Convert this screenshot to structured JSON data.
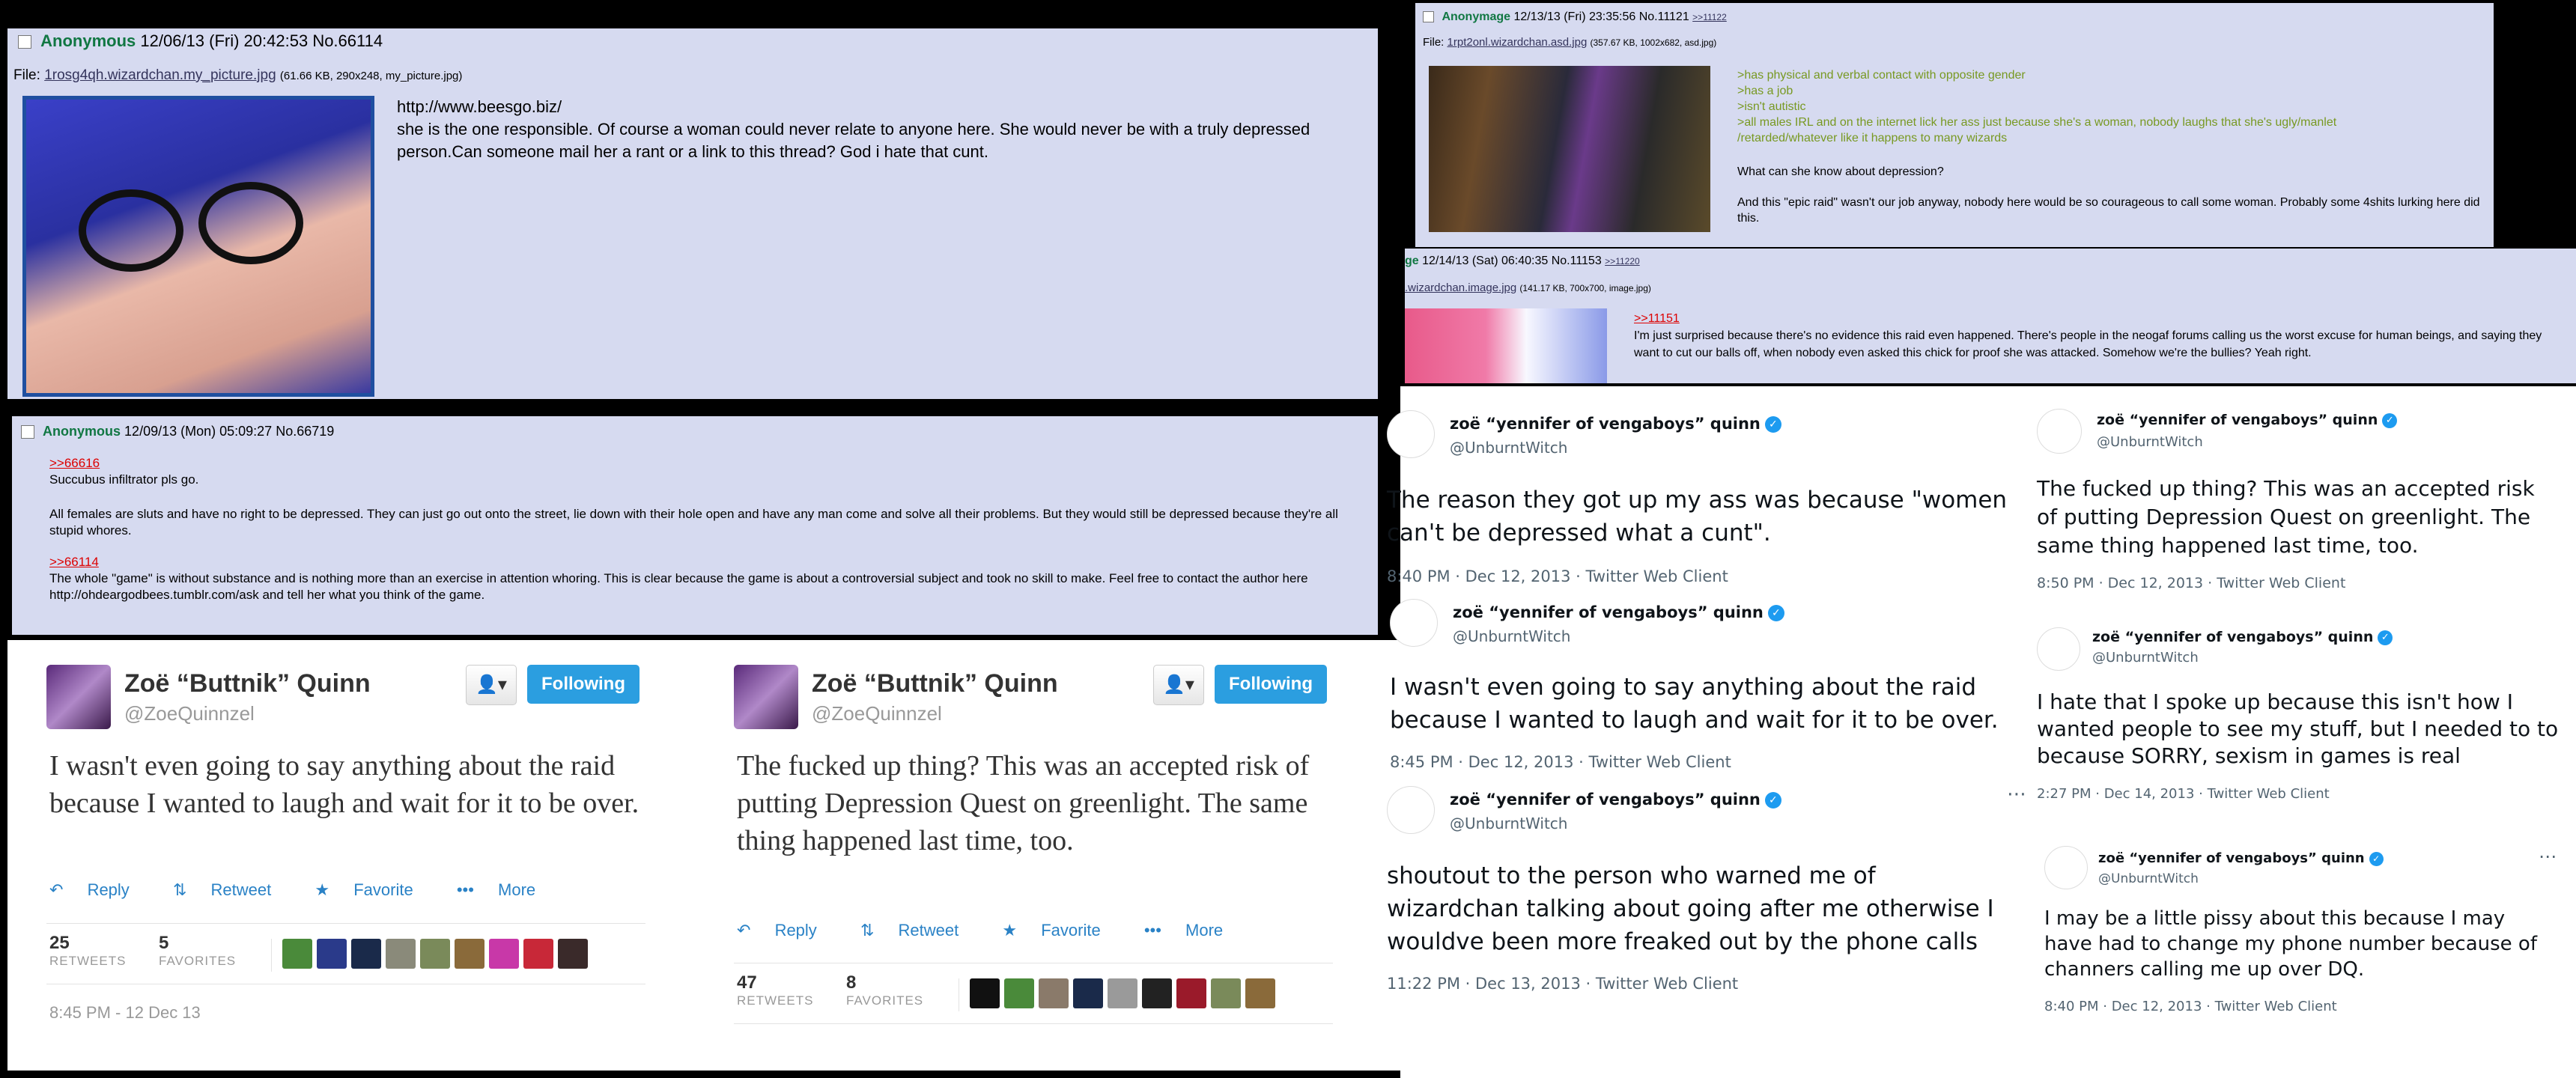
{
  "post1": {
    "name": "Anonymous",
    "datetime": "12/06/13 (Fri) 20:42:53",
    "number": "No.66114",
    "file_label": "File:",
    "file_name": "1rosg4qh.wizardchan.my_picture.jpg",
    "file_info": "(61.66 KB, 290x248, my_picture.jpg)",
    "line1": "http://www.beesgo.biz/",
    "line2": "she is the one responsible. Of course a woman could never relate to anyone here. She would never be with a truly depressed person.Can someone mail her a rant or a link to this thread? God i hate that cunt."
  },
  "post2": {
    "name": "Anonymous",
    "datetime": "12/09/13 (Mon) 05:09:27",
    "number": "No.66719",
    "qlink1": ">>66616",
    "line1": "Succubus infiltrator pls go.",
    "line2": "All females are sluts and have no right to be depressed. They can just go out onto the street, lie down with their hole open and have any man come and solve all their problems. But they would still be depressed because they're all stupid whores.",
    "qlink2": ">>66114",
    "line3": "The whole \"game\" is without substance and is nothing more than an exercise in attention whoring. This is clear because the game is about a controversial subject and took no skill to make. Feel free to contact the author here http://ohdeargodbees.tumblr.com/ask and tell her what you think of the game."
  },
  "post3": {
    "name": "Anonymage",
    "datetime": "12/13/13 (Fri) 23:35:56",
    "number": "No.11121",
    "reply_link": ">>11122",
    "file_label": "File:",
    "file_name": "1rpt2onl.wizardchan.asd.jpg",
    "file_info": "(357.67 KB, 1002x682, asd.jpg)",
    "quotes": [
      ">has physical and verbal contact with opposite gender",
      ">has a job",
      ">isn't autistic",
      ">all males IRL and on the internet lick her ass just because she's a woman, nobody laughs that she's ugly/manlet",
      "/retarded/whatever like it happens to many wizards"
    ],
    "line1": "What can she know about depression?",
    "line2": "And this \"epic raid\" wasn't our job anyway, nobody here would be so courageous to call some woman. Probably some 4shits lurking here did this."
  },
  "post4": {
    "name_fragment": "ge",
    "datetime": "12/14/13 (Sat) 06:40:35",
    "number": "No.11153",
    "reply_link": ">>11220",
    "file_name": ".wizardchan.image.jpg",
    "file_info": "(141.17 KB, 700x700, image.jpg)",
    "qlink": ">>11151",
    "line1": "I'm just surprised because there's no evidence this raid even happened. There's people in the neogaf forums calling us the worst excuse for human beings, and saying they want to cut our balls off, when nobody even asked this chick for proof she was attacked. Somehow we're the bullies? Yeah right."
  },
  "legacy_user": {
    "name": "Zoë “Buttnik” Quinn",
    "handle": "@ZoeQuinnzel",
    "user_icon": "user-dropdown-icon",
    "follow_label": "Following",
    "reply_label": "Reply",
    "retweet_label": "Retweet",
    "favorite_label": "Favorite",
    "more_label": "More",
    "retweets_caption": "RETWEETS",
    "favorites_caption": "FAVORITES"
  },
  "legacy_tweet1": {
    "text": "I wasn't even going to say anything about the raid because I wanted to laugh and wait for it to be over.",
    "retweets": "25",
    "favorites": "5",
    "date": "8:45 PM - 12 Dec 13"
  },
  "legacy_tweet2": {
    "text": "The fucked up thing? This was an accepted risk of putting Depression Quest on greenlight. The same thing happened last time, too.",
    "retweets": "47",
    "favorites": "8"
  },
  "modern_user": {
    "name": "zoë “yennifer of vengaboys” quinn",
    "handle": "@UnburntWitch",
    "verified_icon": "verified-badge-icon",
    "client": "Twitter Web Client",
    "more_icon": "ellipsis-icon"
  },
  "modern_tweets": [
    {
      "text": "The reason they got up my ass was because \"women can't be depressed what a cunt\".",
      "meta": "8:40 PM · Dec 12, 2013 · Twitter Web Client"
    },
    {
      "text": "I wasn't even going to say anything about the raid because I wanted to laugh and wait for it to be over.",
      "meta": "8:45 PM · Dec 12, 2013 · Twitter Web Client"
    },
    {
      "text": "shoutout to the person who warned me of wizardchan talking about going after me otherwise I wouldve been more freaked out by the phone calls",
      "meta": "11:22 PM · Dec 13, 2013 · Twitter Web Client"
    },
    {
      "text": "The fucked up thing? This was an accepted risk of putting Depression Quest on greenlight. The same thing happened last time, too.",
      "meta": "8:50 PM · Dec 12, 2013 · Twitter Web Client"
    },
    {
      "text": "I hate that I spoke up because this isn't how I wanted people to see my stuff, but I needed to to because SORRY, sexism in games is real",
      "meta": "2:27 PM · Dec 14, 2013 · Twitter Web Client"
    },
    {
      "text": "I may be a little pissy about this because I may have had to change my phone number because of channers calling me up over DQ.",
      "meta": "8:40 PM · Dec 12, 2013 · Twitter Web Client"
    }
  ],
  "colors": {
    "chan_bg": "#d6daf0",
    "chan_name": "#117743",
    "quote_green": "#789922",
    "quote_link": "#dd0000",
    "follow_blue": "#2b9ee0",
    "verified_blue": "#1d9bf0"
  }
}
